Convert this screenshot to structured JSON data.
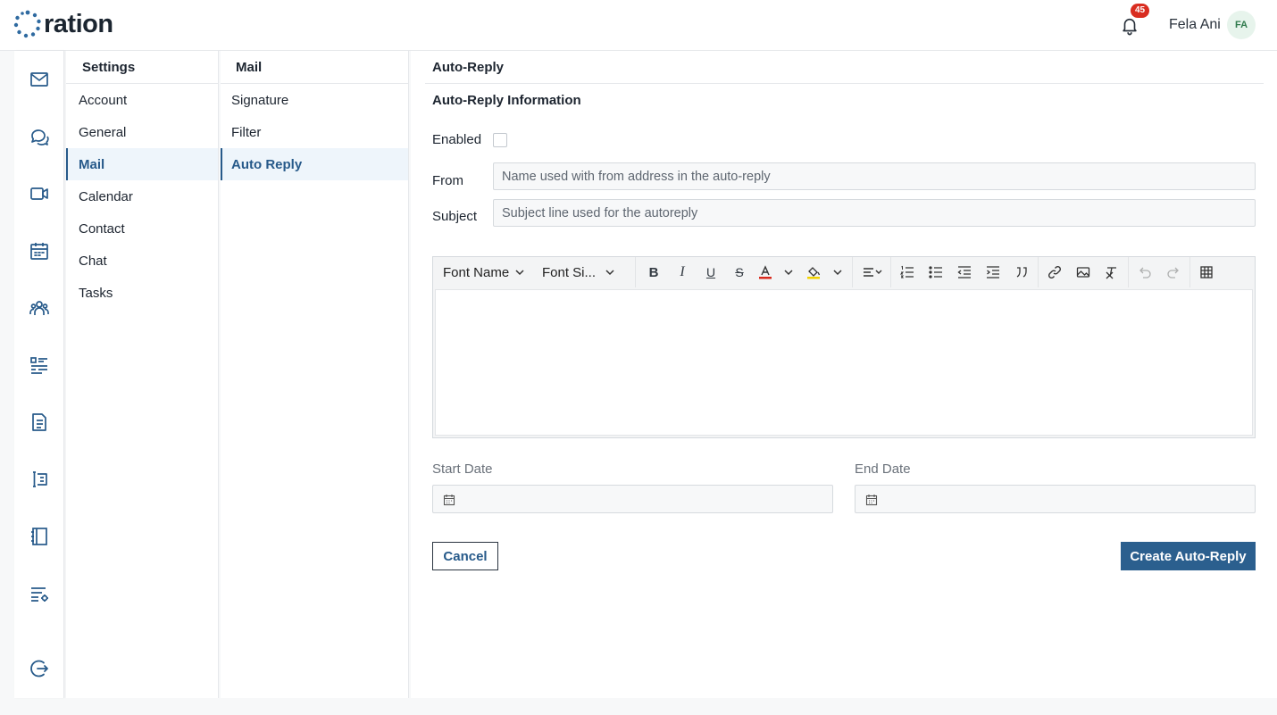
{
  "app": {
    "logo_text": "ration",
    "brand_color": "#275a8a"
  },
  "header": {
    "notification_count": "45",
    "user_name": "Fela Ani",
    "user_initials": "FA"
  },
  "iconbar": {
    "items": [
      {
        "icon": "mail-icon"
      },
      {
        "icon": "chat-icon"
      },
      {
        "icon": "video-icon"
      },
      {
        "icon": "calendar-icon"
      },
      {
        "icon": "contacts-icon"
      },
      {
        "icon": "tasks-icon"
      },
      {
        "icon": "document-icon"
      },
      {
        "icon": "form-icon"
      },
      {
        "icon": "notebook-icon"
      },
      {
        "icon": "settings-list-icon"
      },
      {
        "icon": "logout-icon"
      }
    ]
  },
  "settings_menu": {
    "title": "Settings",
    "items": [
      {
        "label": "Account"
      },
      {
        "label": "General"
      },
      {
        "label": "Mail",
        "active": true
      },
      {
        "label": "Calendar"
      },
      {
        "label": "Contact"
      },
      {
        "label": "Chat"
      },
      {
        "label": "Tasks"
      }
    ]
  },
  "mail_menu": {
    "title": "Mail",
    "items": [
      {
        "label": "Signature"
      },
      {
        "label": "Filter"
      },
      {
        "label": "Auto Reply",
        "active": true
      }
    ]
  },
  "main": {
    "title": "Auto-Reply",
    "section_title": "Auto-Reply Information",
    "enabled_label": "Enabled",
    "enabled": false,
    "from_label": "From",
    "from_placeholder": "Name used with from address in the auto-reply",
    "subject_label": "Subject",
    "subject_placeholder": "Subject line used for the autoreply",
    "editor": {
      "font_name": "Font Name",
      "font_size": "Font Si..."
    },
    "start_date_label": "Start Date",
    "end_date_label": "End Date",
    "cancel_label": "Cancel",
    "create_label": "Create Auto-Reply"
  }
}
